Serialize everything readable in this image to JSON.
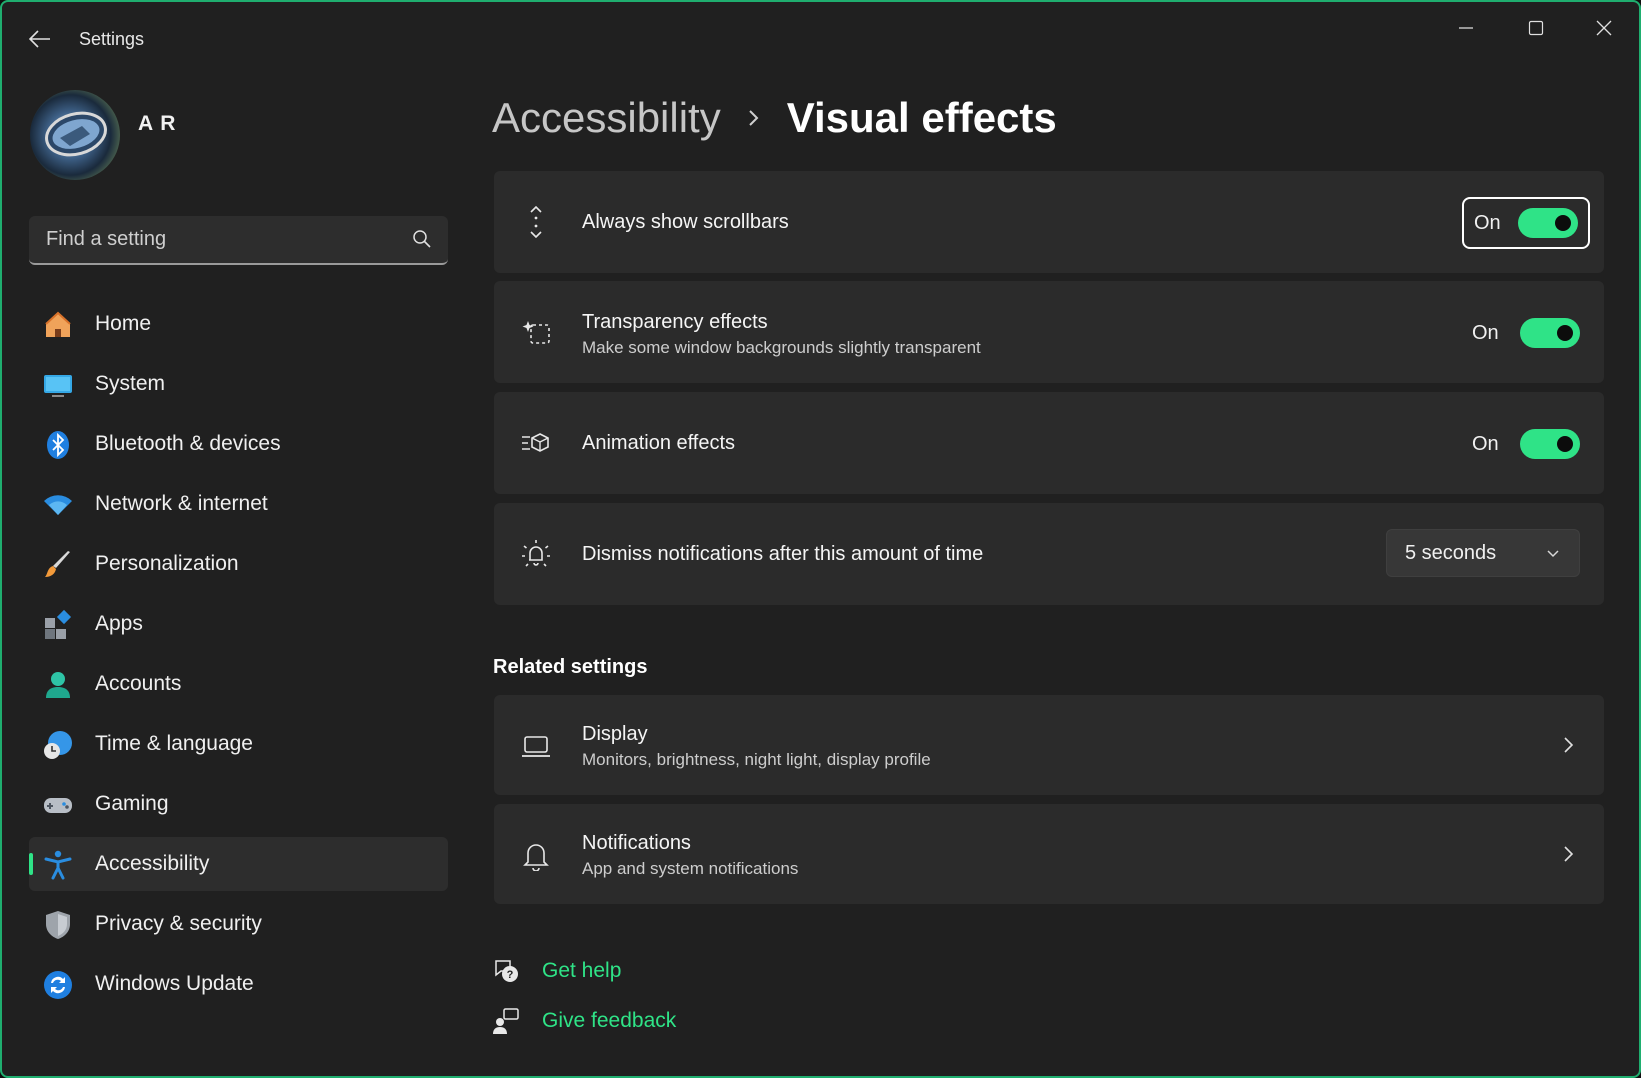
{
  "app": {
    "title": "Settings"
  },
  "profile": {
    "name": "A R"
  },
  "search": {
    "placeholder": "Find a setting"
  },
  "sidebar": {
    "items": [
      {
        "label": "Home",
        "icon": "home-icon"
      },
      {
        "label": "System",
        "icon": "system-icon"
      },
      {
        "label": "Bluetooth & devices",
        "icon": "bluetooth-icon"
      },
      {
        "label": "Network & internet",
        "icon": "wifi-icon"
      },
      {
        "label": "Personalization",
        "icon": "brush-icon"
      },
      {
        "label": "Apps",
        "icon": "apps-icon"
      },
      {
        "label": "Accounts",
        "icon": "accounts-icon"
      },
      {
        "label": "Time & language",
        "icon": "time-language-icon"
      },
      {
        "label": "Gaming",
        "icon": "gamepad-icon"
      },
      {
        "label": "Accessibility",
        "icon": "accessibility-icon",
        "active": true
      },
      {
        "label": "Privacy & security",
        "icon": "shield-icon"
      },
      {
        "label": "Windows Update",
        "icon": "update-icon"
      }
    ]
  },
  "breadcrumb": {
    "parent": "Accessibility",
    "current": "Visual effects"
  },
  "settings": [
    {
      "title": "Always show scrollbars",
      "subtitle": "",
      "control": "toggle",
      "state": "On",
      "icon": "scrollbar-icon"
    },
    {
      "title": "Transparency effects",
      "subtitle": "Make some window backgrounds slightly transparent",
      "control": "toggle",
      "state": "On",
      "icon": "transparency-icon"
    },
    {
      "title": "Animation effects",
      "subtitle": "",
      "control": "toggle",
      "state": "On",
      "icon": "animation-icon"
    },
    {
      "title": "Dismiss notifications after this amount of time",
      "subtitle": "",
      "control": "dropdown",
      "value": "5 seconds",
      "icon": "notification-timer-icon"
    }
  ],
  "related": {
    "title": "Related settings",
    "items": [
      {
        "title": "Display",
        "subtitle": "Monitors, brightness, night light, display profile",
        "icon": "laptop-icon"
      },
      {
        "title": "Notifications",
        "subtitle": "App and system notifications",
        "icon": "bell-icon"
      }
    ]
  },
  "footer": {
    "help": "Get help",
    "feedback": "Give feedback"
  },
  "colors": {
    "accent": "#2fe387",
    "background": "#202020",
    "card": "#2b2b2b",
    "window_border": "#1fae6f"
  }
}
